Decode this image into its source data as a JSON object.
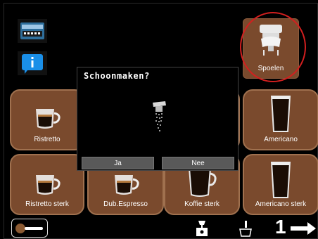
{
  "dialog": {
    "title": "Schoonmaken?",
    "confirm_label": "Ja",
    "cancel_label": "Nee",
    "icon": "spray-cleaning-icon"
  },
  "rinse_button": {
    "label": "Spoelen",
    "icon": "rinse-nozzle-icon"
  },
  "status_icons": [
    "card-reader-icon",
    "info-icon"
  ],
  "drinks": [
    {
      "label": "Ristretto",
      "icon": "espresso-cup-icon"
    },
    {
      "label": "Americano",
      "icon": "tall-glass-icon"
    },
    {
      "label": "Ristretto sterk",
      "icon": "espresso-cup-icon"
    },
    {
      "label": "Dub.Espresso",
      "icon": "espresso-cup-icon"
    },
    {
      "label": "Koffie sterk",
      "icon": "coffee-cup-icon"
    },
    {
      "label": "Americano sterk",
      "icon": "tall-glass-icon"
    }
  ],
  "bottom_bar": {
    "cup_count": "1",
    "icons": [
      "bean-scoop-icon",
      "grinder-icon",
      "dispense-icon",
      "arrow-right-icon"
    ]
  },
  "colors": {
    "tile": "#7a4a2d",
    "dialog_button": "#595959",
    "highlight_ring": "#d21f1f"
  }
}
